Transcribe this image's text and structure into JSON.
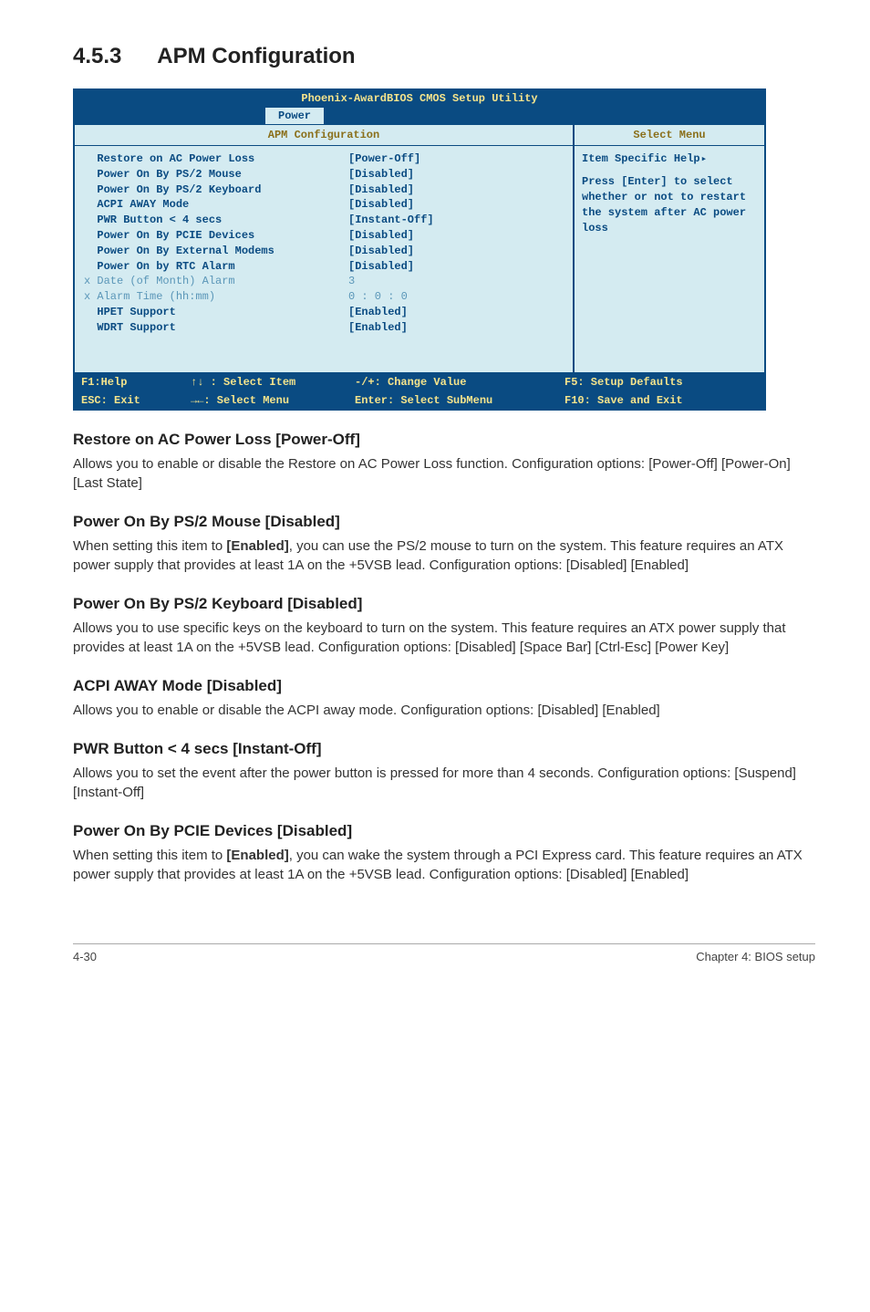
{
  "page": {
    "section_number": "4.5.3",
    "section_title": "APM Configuration",
    "footer_left": "4-30",
    "footer_right": "Chapter 4: BIOS setup"
  },
  "bios": {
    "title": "Phoenix-AwardBIOS CMOS Setup Utility",
    "tab": "Power",
    "left_header": "APM Configuration",
    "right_header": "Select Menu",
    "help": {
      "line1": "Item Specific Help",
      "line2": "Press [Enter] to select whether or not to restart the system after AC power loss"
    },
    "rows": [
      {
        "label": "  Restore on AC Power Loss",
        "value": "[Power-Off]",
        "dim": false
      },
      {
        "label": "  Power On By PS/2 Mouse",
        "value": "[Disabled]",
        "dim": false
      },
      {
        "label": "  Power On By PS/2 Keyboard",
        "value": "[Disabled]",
        "dim": false
      },
      {
        "label": "  ACPI AWAY Mode",
        "value": "[Disabled]",
        "dim": false
      },
      {
        "label": "  PWR Button < 4 secs",
        "value": "[Instant-Off]",
        "dim": false
      },
      {
        "label": "  Power On By PCIE Devices",
        "value": "[Disabled]",
        "dim": false
      },
      {
        "label": "  Power On By External Modems",
        "value": "[Disabled]",
        "dim": false
      },
      {
        "label": "  Power On by RTC Alarm",
        "value": "[Disabled]",
        "dim": false
      },
      {
        "label": "x Date (of Month) Alarm",
        "value": "    3",
        "dim": true
      },
      {
        "label": "x Alarm Time (hh:mm)",
        "value": "0 : 0 : 0",
        "dim": true
      },
      {
        "label": "  HPET Support",
        "value": "[Enabled]",
        "dim": false
      },
      {
        "label": "  WDRT Support",
        "value": "[Enabled]",
        "dim": false
      }
    ],
    "footer": {
      "r1c1": "F1:Help",
      "r1c2": "↑↓ : Select Item",
      "r1c3": "-/+: Change Value",
      "r1c4": "F5: Setup Defaults",
      "r2c1": "ESC: Exit",
      "r2c2": "→←: Select Menu",
      "r2c3": "Enter: Select SubMenu",
      "r2c4": "F10: Save and Exit"
    }
  },
  "sections": [
    {
      "heading": "Restore on AC Power Loss [Power-Off]",
      "body": "Allows you to enable or disable the Restore on AC Power Loss function. Configuration options: [Power-Off] [Power-On] [Last State]"
    },
    {
      "heading": "Power On By PS/2 Mouse [Disabled]",
      "body": "When setting this item to [Enabled], you can use the PS/2 mouse to turn on the system. This feature requires an ATX power supply that provides at least 1A on the +5VSB lead. Configuration options: [Disabled] [Enabled]"
    },
    {
      "heading": "Power On By PS/2 Keyboard [Disabled]",
      "body": "Allows you to use specific keys on the keyboard to turn on the system. This feature requires an ATX power supply that provides at least 1A on the +5VSB lead. Configuration options: [Disabled] [Space Bar] [Ctrl-Esc] [Power Key]"
    },
    {
      "heading": "ACPI AWAY Mode [Disabled]",
      "body": "Allows you to enable or disable the ACPI away mode. Configuration options: [Disabled] [Enabled]"
    },
    {
      "heading": "PWR Button < 4 secs [Instant-Off]",
      "body": "Allows you to set the event after the power button is pressed for more than 4 seconds. Configuration options: [Suspend] [Instant-Off]"
    },
    {
      "heading": "Power On By PCIE Devices [Disabled]",
      "body": "When setting this item to [Enabled], you can wake the system through a PCI Express card. This feature requires an ATX power supply that provides at least 1A on the +5VSB lead.  Configuration options: [Disabled] [Enabled]"
    }
  ]
}
